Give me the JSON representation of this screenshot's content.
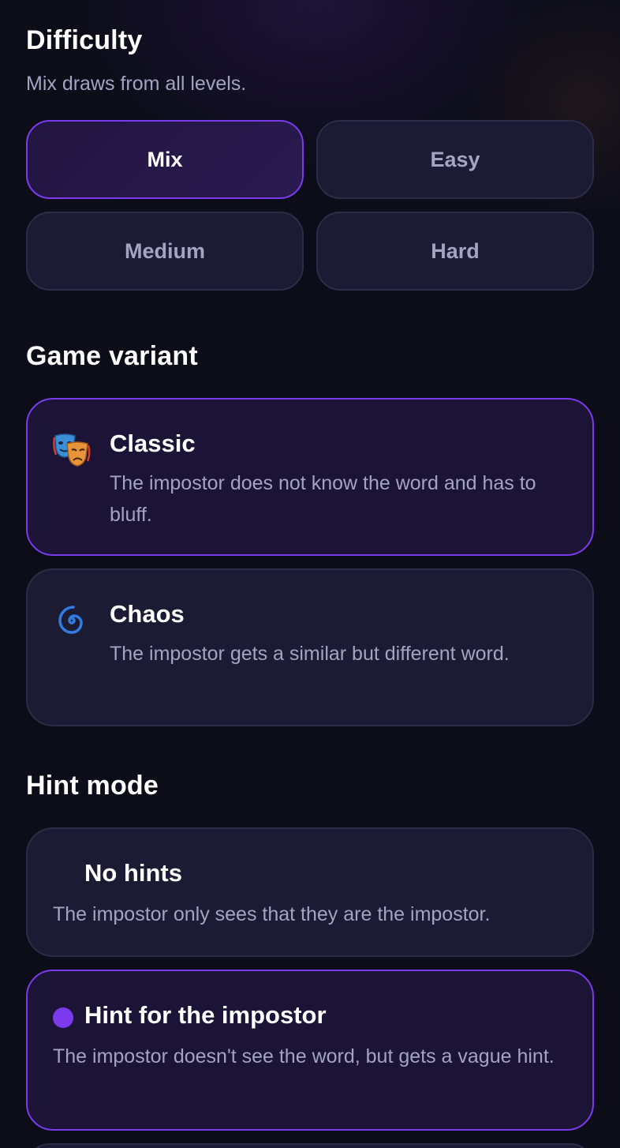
{
  "difficulty": {
    "title": "Difficulty",
    "subtitle": "Mix draws from all levels.",
    "options": [
      {
        "label": "Mix",
        "selected": true
      },
      {
        "label": "Easy",
        "selected": false
      },
      {
        "label": "Medium",
        "selected": false
      },
      {
        "label": "Hard",
        "selected": false
      }
    ]
  },
  "variant": {
    "title": "Game variant",
    "options": [
      {
        "icon": "theater-masks-icon",
        "title": "Classic",
        "description": "The impostor does not know the word and has to bluff.",
        "selected": true
      },
      {
        "icon": "cyclone-icon",
        "title": "Chaos",
        "description": "The impostor gets a similar but different word.",
        "selected": false
      }
    ]
  },
  "hint": {
    "title": "Hint mode",
    "options": [
      {
        "title": "No hints",
        "description": "The impostor only sees that they are the impostor.",
        "selected": false
      },
      {
        "title": "Hint for the impostor",
        "description": "The impostor doesn't see the word, but gets a vague hint.",
        "selected": true
      }
    ]
  },
  "colors": {
    "accent": "#7c3aed",
    "background": "#0d0d1a",
    "card": "#1b1b33",
    "muted_text": "#a3a3c2"
  }
}
